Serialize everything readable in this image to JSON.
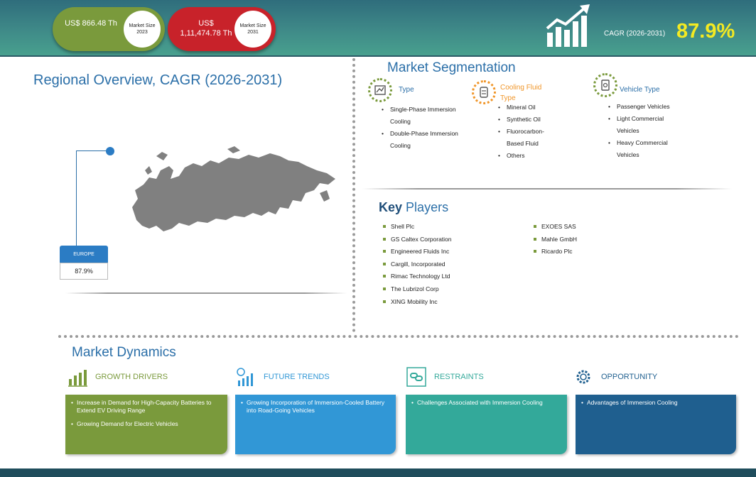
{
  "header": {
    "market_2023": {
      "value": "US$ 866.48 Th",
      "label_line1": "Market Size",
      "label_line2": "2023"
    },
    "market_2031": {
      "value": "US$ 1,11,474.78 Th",
      "label_line1": "Market Size",
      "label_line2": "2031"
    },
    "cagr_label": "CAGR (2026-2031)",
    "cagr_value": "87.9%"
  },
  "regional": {
    "title": "Regional Overview, CAGR (2026-2031)",
    "region_name": "EUROPE",
    "region_value": "87.9%"
  },
  "segmentation": {
    "title": "Market Segmentation",
    "groups": [
      {
        "heading": "Type",
        "items": [
          "Single-Phase Immersion Cooling",
          "Double-Phase Immersion Cooling"
        ]
      },
      {
        "heading": "Cooling Fluid Type",
        "items": [
          "Mineral Oil",
          "Synthetic Oil",
          "Fluorocarbon-Based Fluid",
          "Others"
        ]
      },
      {
        "heading": "Vehicle Type",
        "items": [
          "Passenger Vehicles",
          "Light Commercial Vehicles",
          "Heavy Commercial Vehicles"
        ]
      }
    ]
  },
  "key_players": {
    "title_bold": "Key",
    "title_rest": "Players",
    "col1": [
      "Shell Plc",
      "GS Caltex Corporation",
      "Engineered Fluids Inc",
      "Cargill, Incorporated",
      "Rimac Technology Ltd",
      "The Lubrizol Corp",
      "XING Mobility Inc"
    ],
    "col2": [
      "EXOES SAS",
      "Mahle GmbH",
      "Ricardo Plc"
    ]
  },
  "dynamics": {
    "title": "Market Dynamics",
    "sections": [
      {
        "heading": "GROWTH DRIVERS",
        "color": "#7a9a3c",
        "icon": "bar-chart-icon",
        "items": [
          "Increase in Demand for High-Capacity Batteries to Extend EV Driving Range",
          "Growing Demand for Electric Vehicles"
        ]
      },
      {
        "heading": "FUTURE TRENDS",
        "color": "#3197d6",
        "icon": "trend-icon",
        "items": [
          "Growing Incorporation of Immersion-Cooled Battery into Road-Going Vehicles"
        ]
      },
      {
        "heading": "RESTRAINTS",
        "color": "#33a99a",
        "icon": "chain-icon",
        "items": [
          "Challenges Associated with Immersion Cooling"
        ]
      },
      {
        "heading": "OPPORTUNITY",
        "color": "#1f5f8f",
        "icon": "gear-icon",
        "items": [
          "Advantages of Immersion Cooling"
        ]
      }
    ]
  }
}
